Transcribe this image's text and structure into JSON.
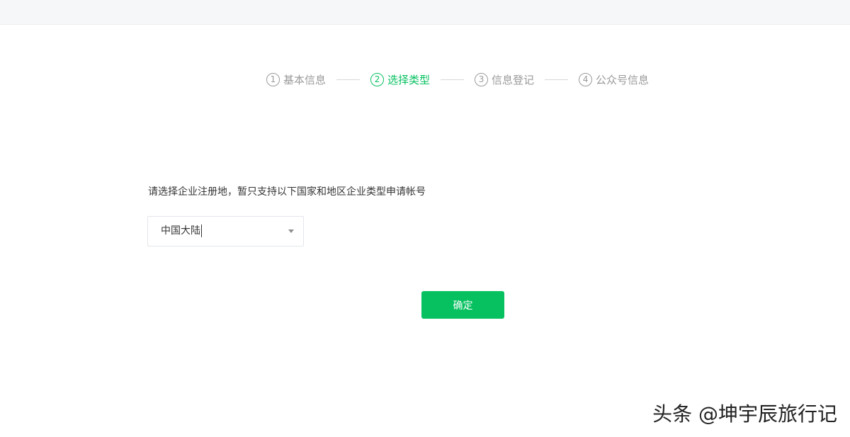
{
  "steps": [
    {
      "num": "1",
      "label": "基本信息",
      "active": false
    },
    {
      "num": "2",
      "label": "选择类型",
      "active": true
    },
    {
      "num": "3",
      "label": "信息登记",
      "active": false
    },
    {
      "num": "4",
      "label": "公众号信息",
      "active": false
    }
  ],
  "form": {
    "hint": "请选择企业注册地，暂只支持以下国家和地区企业类型申请帐号",
    "region_value": "中国大陆"
  },
  "confirm_label": "确定",
  "watermark": "头条 @坤宇辰旅行记",
  "colors": {
    "accent": "#07c160",
    "inactive": "#9a9a9a",
    "text": "#353535"
  }
}
